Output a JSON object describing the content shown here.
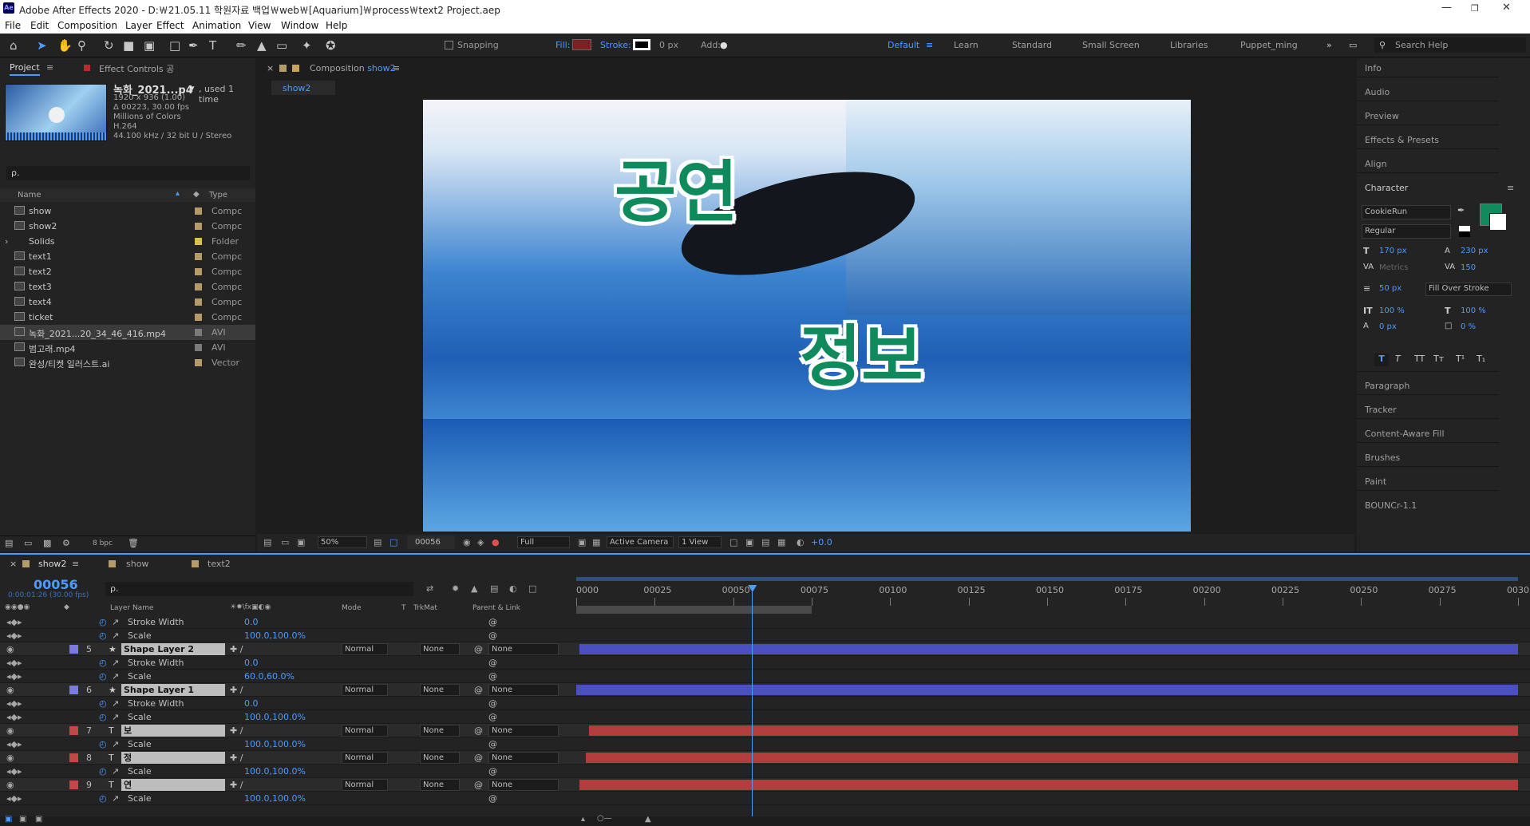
{
  "app": {
    "title": "Adobe After Effects 2020 - D:￦21.05.11 학원자료 백업￦web￦[Aquarium]￦process￦text2 Project.aep",
    "icon_text": "Ae"
  },
  "menu": [
    "File",
    "Edit",
    "Composition",
    "Layer",
    "Effect",
    "Animation",
    "View",
    "Window",
    "Help"
  ],
  "toolbar": {
    "snapping": "Snapping",
    "fill_label": "Fill:",
    "stroke_label": "Stroke:",
    "stroke_px": "0 px",
    "add_label": "Add:",
    "workspaces": [
      "Default",
      "Learn",
      "Standard",
      "Small Screen",
      "Libraries",
      "Puppet_ming"
    ],
    "search_help": "Search Help"
  },
  "project": {
    "tab": "Project",
    "effect_controls_tab": "Effect Controls 공",
    "selected": {
      "name": "녹화_2021...p4",
      "used": ", used 1 time",
      "details": [
        "1920 x 936 (1.00)",
        "Δ 00223, 30.00 fps",
        "Millions of Colors",
        "H.264",
        "44.100 kHz / 32 bit U / Stereo"
      ]
    },
    "search_placeholder": "ρ.",
    "columns": {
      "name": "Name",
      "type": "Type"
    },
    "items": [
      {
        "name": "show",
        "type": "Compc",
        "color": "#b59a6a"
      },
      {
        "name": "show2",
        "type": "Compc",
        "color": "#b59a6a"
      },
      {
        "name": "Solids",
        "type": "Folder",
        "color": "#d8c34a"
      },
      {
        "name": "text1",
        "type": "Compc",
        "color": "#b59a6a"
      },
      {
        "name": "text2",
        "type": "Compc",
        "color": "#b59a6a"
      },
      {
        "name": "text3",
        "type": "Compc",
        "color": "#b59a6a"
      },
      {
        "name": "text4",
        "type": "Compc",
        "color": "#b59a6a"
      },
      {
        "name": "ticket",
        "type": "Compc",
        "color": "#b59a6a"
      },
      {
        "name": "녹화_2021...20_34_46_416.mp4",
        "type": "AVI",
        "color": "#7b7b7b"
      },
      {
        "name": "범고래.mp4",
        "type": "AVI",
        "color": "#7b7b7b"
      },
      {
        "name": "완성/티켓 일러스트.ai",
        "type": "Vector",
        "color": "#b59a6a"
      }
    ],
    "bpc": "8 bpc"
  },
  "composition": {
    "tab": "Composition",
    "tab_name": "show2",
    "sub_tab": "show2",
    "overlay_text_1": "공연",
    "overlay_text_2": "정보",
    "footer": {
      "zoom": "50%",
      "timecode": "00056",
      "resolution": "Full",
      "camera": "Active Camera",
      "view": "1 View",
      "exposure": "+0.0"
    }
  },
  "right_panel": {
    "items": [
      "Info",
      "Audio",
      "Preview",
      "Effects & Presets",
      "Align",
      "Character",
      "Paragraph",
      "Tracker",
      "Content-Aware Fill",
      "Brushes",
      "Paint",
      "BOUNCr-1.1"
    ],
    "character": {
      "font": "CookieRun",
      "style": "Regular",
      "size": "170 px",
      "leading": "230 px",
      "kerning": "Metrics",
      "tracking": "150",
      "stroke_width": "50 px",
      "stroke_mode": "Fill Over Stroke",
      "v_scale": "100 %",
      "h_scale": "100 %",
      "baseline": "0 px",
      "tsume": "0 %",
      "fill_color": "#0f8a5c"
    }
  },
  "timeline": {
    "tabs": [
      {
        "name": "show2",
        "color": "#b59a6a"
      },
      {
        "name": "show",
        "color": "#b59a6a"
      },
      {
        "name": "text2",
        "color": "#b59a6a"
      }
    ],
    "timecode": "00056",
    "timecode_sub": "0:00:01:26 (30.00 fps)",
    "columns": {
      "layer_name": "Layer Name",
      "mode": "Mode",
      "t": "T",
      "trkmat": "TrkMat",
      "parent": "Parent & Link"
    },
    "ruler": [
      "0000",
      "00025",
      "00050",
      "00075",
      "00100",
      "00125",
      "00150",
      "00175",
      "00200",
      "00225",
      "00250",
      "00275",
      "0030"
    ],
    "playhead_frame": 56,
    "work_area_end_frame": 75,
    "total_frames": 300,
    "rows": [
      {
        "kind": "prop",
        "name": "Stroke Width",
        "value": "0.0"
      },
      {
        "kind": "prop",
        "name": "Scale",
        "value": "100.0,100.0%"
      },
      {
        "kind": "layer",
        "num": "5",
        "name": "Shape Layer 2",
        "mode": "Normal",
        "trkmat": "None",
        "parent": "None",
        "bar": "blue",
        "start": 1
      },
      {
        "kind": "prop",
        "name": "Stroke Width",
        "value": "0.0"
      },
      {
        "kind": "prop",
        "name": "Scale",
        "value": "60.0,60.0%"
      },
      {
        "kind": "layer",
        "num": "6",
        "name": "Shape Layer 1",
        "mode": "Normal",
        "trkmat": "None",
        "parent": "None",
        "bar": "blue",
        "start": 0
      },
      {
        "kind": "prop",
        "name": "Stroke Width",
        "value": "0.0"
      },
      {
        "kind": "prop",
        "name": "Scale",
        "value": "100.0,100.0%"
      },
      {
        "kind": "layer",
        "num": "7",
        "name": "보",
        "mode": "Normal",
        "trkmat": "None",
        "parent": "None",
        "bar": "red",
        "start": 4
      },
      {
        "kind": "prop",
        "name": "Scale",
        "value": "100.0,100.0%"
      },
      {
        "kind": "layer",
        "num": "8",
        "name": "정",
        "mode": "Normal",
        "trkmat": "None",
        "parent": "None",
        "bar": "red",
        "start": 3
      },
      {
        "kind": "prop",
        "name": "Scale",
        "value": "100.0,100.0%"
      },
      {
        "kind": "layer",
        "num": "9",
        "name": "연",
        "mode": "Normal",
        "trkmat": "None",
        "parent": "None",
        "bar": "red",
        "start": 1
      },
      {
        "kind": "prop",
        "name": "Scale",
        "value": "100.0,100.0%"
      }
    ]
  }
}
